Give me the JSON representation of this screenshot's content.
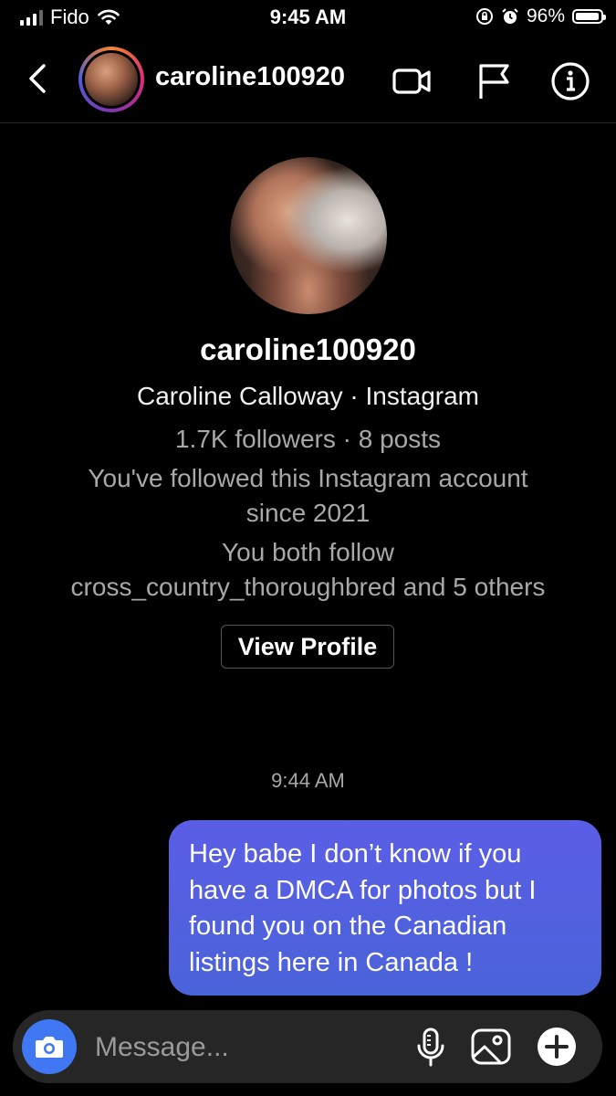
{
  "status_bar": {
    "carrier": "Fido",
    "time": "9:45 AM",
    "battery": "96%",
    "battery_level": 0.96
  },
  "header": {
    "username": "caroline100920",
    "icons": [
      "back-chevron-icon",
      "video-call-icon",
      "report-flag-icon",
      "info-icon"
    ]
  },
  "profile": {
    "username": "caroline100920",
    "subtitle": "Caroline Calloway · Instagram",
    "stats": "1.7K followers · 8 posts",
    "followed_since_1": "You've followed this Instagram account",
    "followed_since_2": "since 2021",
    "mutual_1": "You both follow",
    "mutual_2": "cross_country_thoroughbred and 5 others",
    "view_profile_label": "View Profile"
  },
  "conversation": {
    "timestamp": "9:44 AM",
    "messages": [
      {
        "from": "me",
        "lines": [
          "Hey babe I don’t know if you",
          "have a DMCA for photos but I",
          "found you on the Canadian",
          "listings here in Canada !"
        ]
      }
    ]
  },
  "composer": {
    "placeholder": "Message...",
    "icons": [
      "camera-icon",
      "microphone-icon",
      "gallery-icon",
      "add-icon"
    ]
  },
  "colors": {
    "background": "#000000",
    "bubble": "#4f62de",
    "camera_button": "#3f78f2",
    "composer": "#262626",
    "secondary_text": "#a8a8a8"
  }
}
